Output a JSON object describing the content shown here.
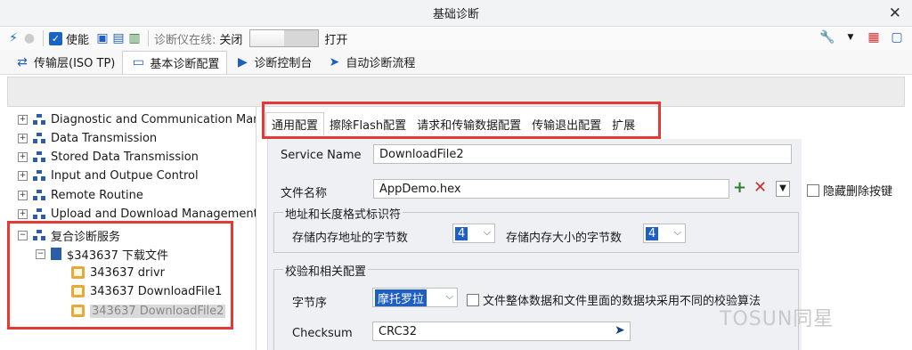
{
  "window": {
    "title": "基础诊断"
  },
  "toolbar": {
    "enable_label": "使能",
    "online_label": "诊断仪在线:",
    "online_state": "关闭",
    "open_label": "打开"
  },
  "main_tabs": [
    {
      "label": "传输层(ISO TP)"
    },
    {
      "label": "基本诊断配置"
    },
    {
      "label": "诊断控制台"
    },
    {
      "label": "自动诊断流程"
    }
  ],
  "tree": {
    "items": [
      "Diagnostic and Communication Managem",
      "Data Transmission",
      "Stored Data Transmission",
      "Input and Outpue Control",
      "Remote Routine",
      "Upload and Download Management"
    ],
    "composite": {
      "label": "复合诊断服务",
      "child": "$343637 下载文件",
      "leaves": [
        "343637 drivr",
        "343637 DownloadFile1",
        "343637 DownloadFile2"
      ]
    }
  },
  "sub_tabs": [
    "通用配置",
    "擦除Flash配置",
    "请求和传输数据配置",
    "传输退出配置",
    "扩展"
  ],
  "form": {
    "service_name_label": "Service Name",
    "service_name_value": "DownloadFile2",
    "file_name_label": "文件名称",
    "file_name_value": "AppDemo.hex",
    "hide_delete_label": "隐藏删除按键",
    "addr_group_title": "地址和长度格式标识符",
    "addr_bytes_label": "存储内存地址的字节数",
    "addr_bytes_value": "4",
    "size_bytes_label": "存储内存大小的字节数",
    "size_bytes_value": "4",
    "check_group_title": "校验和相关配置",
    "endian_label": "字节序",
    "endian_value": "摩托罗拉",
    "different_algo_label": "文件整体数据和文件里面的数据块采用不同的校验算法",
    "checksum_label": "Checksum",
    "checksum_value": "CRC32"
  },
  "watermark": "TOSUN同星",
  "colors": {
    "highlight_red": "#e53935",
    "accent_blue": "#1e5fc4"
  }
}
